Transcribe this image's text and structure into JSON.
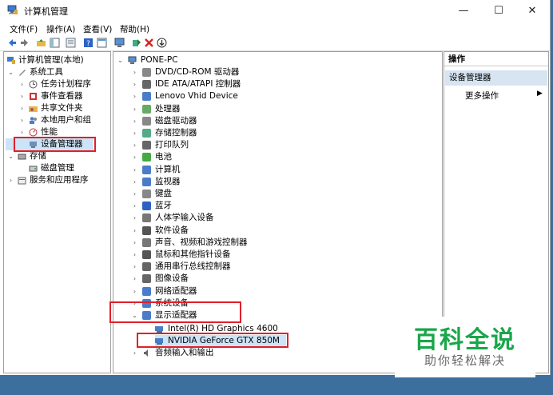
{
  "window": {
    "title": "计算机管理",
    "buttons": {
      "minimize": "—",
      "maximize": "☐",
      "close": "✕"
    }
  },
  "menu": [
    "文件(F)",
    "操作(A)",
    "查看(V)",
    "帮助(H)"
  ],
  "toolbar_icons": [
    "back-arrow-icon",
    "forward-arrow-icon",
    "up-folder-icon",
    "console-tree-icon",
    "properties-icon",
    "help-icon",
    "view-icon",
    "monitor-icon",
    "enable-device-icon",
    "uninstall-x-icon",
    "update-driver-icon"
  ],
  "left_tree": [
    {
      "label": "计算机管理(本地)"
    },
    {
      "label": "系统工具"
    },
    {
      "label": "任务计划程序"
    },
    {
      "label": "事件查看器"
    },
    {
      "label": "共享文件夹"
    },
    {
      "label": "本地用户和组"
    },
    {
      "label": "性能"
    },
    {
      "label": "设备管理器"
    },
    {
      "label": "存储"
    },
    {
      "label": "磁盘管理"
    },
    {
      "label": "服务和应用程序"
    }
  ],
  "device_tree": {
    "root": "PONE-PC",
    "categories": [
      "DVD/CD-ROM 驱动器",
      "IDE ATA/ATAPI 控制器",
      "Lenovo Vhid Device",
      "处理器",
      "磁盘驱动器",
      "存储控制器",
      "打印队列",
      "电池",
      "计算机",
      "监视器",
      "键盘",
      "蓝牙",
      "人体学输入设备",
      "软件设备",
      "声音、视频和游戏控制器",
      "鼠标和其他指针设备",
      "通用串行总线控制器",
      "图像设备",
      "网络适配器",
      "系统设备",
      "显示适配器"
    ],
    "display_adapters": [
      "Intel(R) HD Graphics 4600",
      "NVIDIA GeForce GTX 850M"
    ],
    "after": "音频输入和输出"
  },
  "actions": {
    "header": "操作",
    "section": "设备管理器",
    "more": "更多操作"
  },
  "watermark": {
    "title": "百科全说",
    "subtitle": "助你轻松解决"
  }
}
